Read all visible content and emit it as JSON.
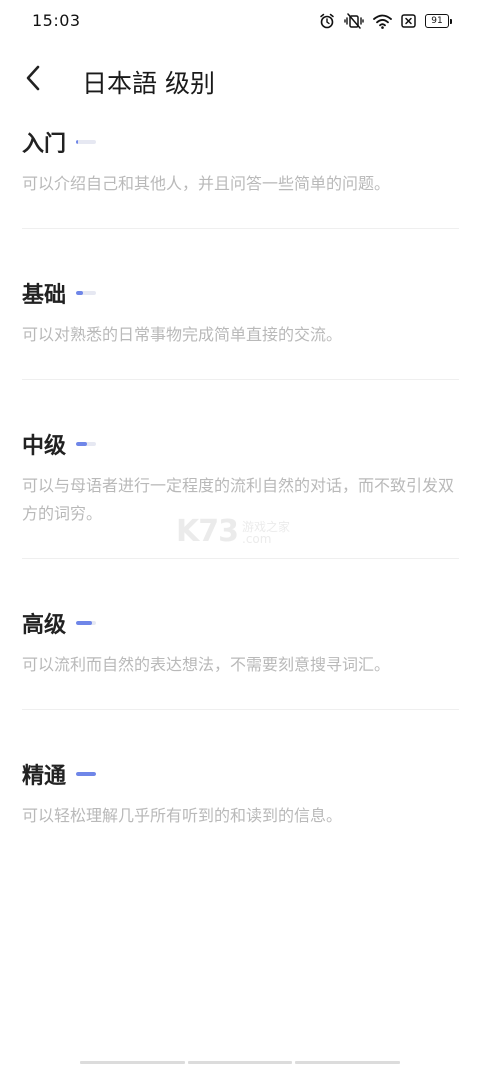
{
  "status_bar": {
    "time": "15:03",
    "battery": "91",
    "icons": [
      "alarm-icon",
      "vibrate-mute-icon",
      "wifi-icon",
      "no-sim-icon",
      "battery-icon"
    ]
  },
  "header": {
    "title": "日本語 级别",
    "back_icon": "chevron-left-icon"
  },
  "levels": [
    {
      "name": "入门",
      "progress": 0.1,
      "description": "可以介绍自己和其他人，并且问答一些简单的问题。"
    },
    {
      "name": "基础",
      "progress": 0.35,
      "description": "可以对熟悉的日常事物完成简单直接的交流。"
    },
    {
      "name": "中级",
      "progress": 0.55,
      "description": "可以与母语者进行一定程度的流利自然的对话，而不致引发双方的词穷。"
    },
    {
      "name": "高级",
      "progress": 0.8,
      "description": "可以流利而自然的表达想法，不需要刻意搜寻词汇。"
    },
    {
      "name": "精通",
      "progress": 1.0,
      "description": "可以轻松理解几乎所有听到的和读到的信息。"
    }
  ],
  "watermark": {
    "logo": "K73",
    "text_cn": "游戏之家",
    "text_com": ".com"
  },
  "colors": {
    "accent": "#6f86e8",
    "track": "#e6e8f2",
    "desc": "#b9b9b9"
  }
}
